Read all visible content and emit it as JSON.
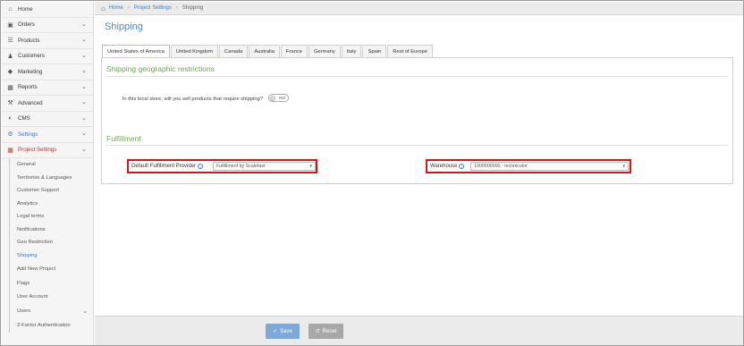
{
  "sidebar": {
    "top_items": [
      {
        "label": "Home",
        "icon": "home-icon"
      },
      {
        "label": "Orders",
        "icon": "cart-icon"
      },
      {
        "label": "Products",
        "icon": "list-icon"
      },
      {
        "label": "Customers",
        "icon": "users-icon"
      },
      {
        "label": "Marketing",
        "icon": "tag-icon"
      },
      {
        "label": "Reports",
        "icon": "bar-chart-icon"
      },
      {
        "label": "Advanced",
        "icon": "wrench-icon"
      },
      {
        "label": "CMS",
        "icon": "gauge-icon"
      },
      {
        "label": "Settings",
        "icon": "cogs-icon"
      },
      {
        "label": "Project Settings",
        "icon": "briefcase-icon"
      }
    ],
    "sub_items": [
      "General",
      "Territories & Languages",
      "Customer Support",
      "Analytics",
      "Legal terms",
      "Notifications",
      "Geo Restriction",
      "Shipping"
    ],
    "tree_items": [
      "Add New Project",
      "Flags",
      "User Account",
      "Users",
      "2-Factor Authentication"
    ]
  },
  "breadcrumb": {
    "home": "Home",
    "project_settings": "Project Settings",
    "current": "Shipping"
  },
  "page_title": "Shipping",
  "tabs": [
    "United States of America",
    "United Kingdom",
    "Canada",
    "Australia",
    "France",
    "Germany",
    "Italy",
    "Spain",
    "Rest of Europe"
  ],
  "restrictions": {
    "title": "Shipping geographic restrictions",
    "question": "In this local store, will you sell products that require shipping?",
    "toggle_value": "NO"
  },
  "fulfillment": {
    "title": "Fulfillment",
    "provider_label": "Default Fulfillment Provider",
    "provider_value": "Fulfillment by Scalefast",
    "warehouse_label": "Warehouse",
    "warehouse_value": "1000000000 - technicolor"
  },
  "buttons": {
    "save": "Save",
    "reset": "Reset"
  },
  "colors": {
    "accent": "#3a7bc8",
    "section": "#6aa84f",
    "highlight": "#d0161d",
    "project": "#c0392b"
  }
}
